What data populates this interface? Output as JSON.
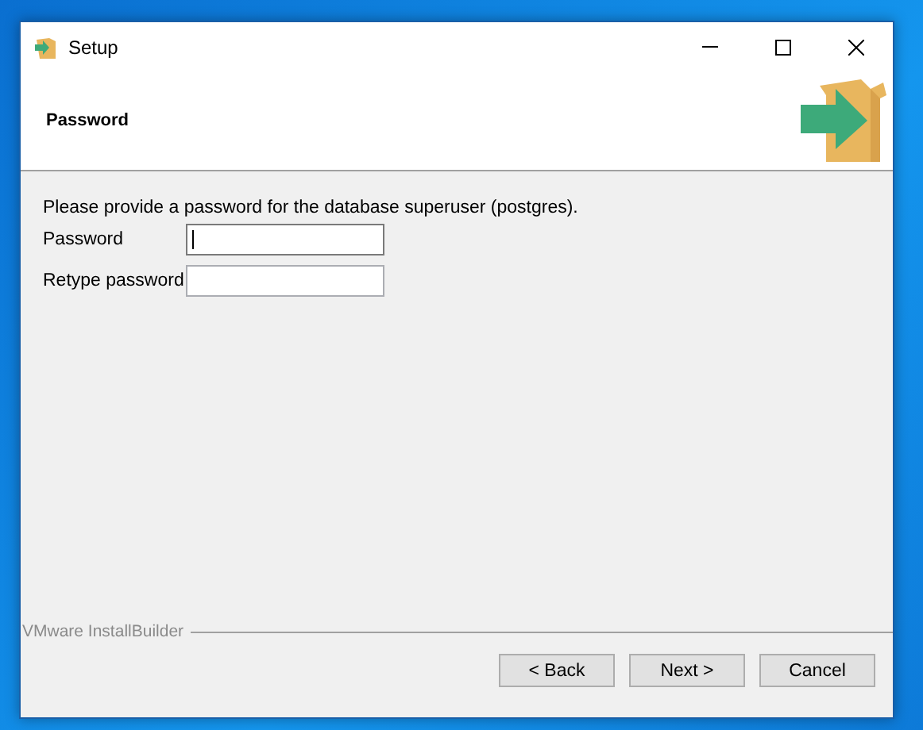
{
  "window": {
    "title": "Setup"
  },
  "header": {
    "title": "Password"
  },
  "intro": "Please provide a password for the database superuser (postgres).",
  "fields": [
    {
      "label": "Password",
      "focused": true
    },
    {
      "label": "Retype password",
      "focused": false
    }
  ],
  "branding": "VMware InstallBuilder",
  "buttons": [
    "< Back",
    "Next >",
    "Cancel"
  ]
}
